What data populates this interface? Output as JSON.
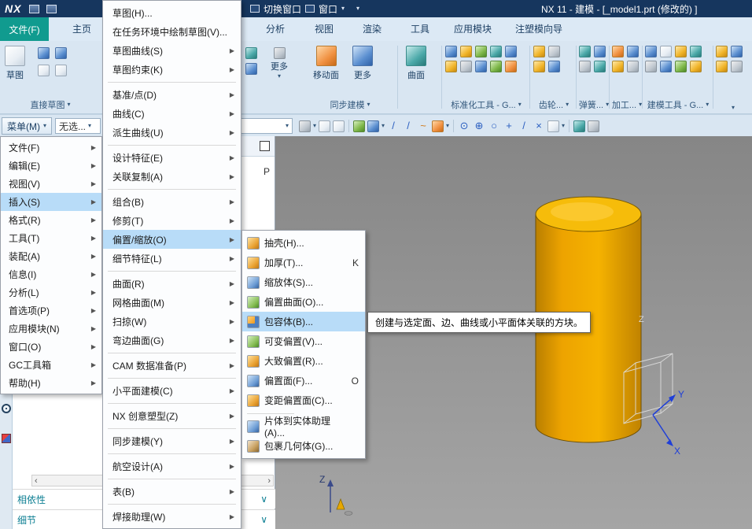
{
  "glyphs": {
    "caret": "▾",
    "arrow": "▶",
    "chevron_down": "∨",
    "scroll_left": "‹",
    "scroll_right": "›"
  },
  "title_bar": {
    "logo": "NX",
    "switch_window": "切换窗口",
    "window_menu": "窗口",
    "title": "NX 11 - 建模 - [_model1.prt (修改的) ]"
  },
  "tabs": {
    "file": "文件(F)",
    "items": [
      {
        "label": "主页"
      },
      {
        "label": "分析"
      },
      {
        "label": "视图"
      },
      {
        "label": "渲染"
      },
      {
        "label": "工具"
      },
      {
        "label": "应用模块"
      },
      {
        "label": "注塑模向导"
      }
    ]
  },
  "ribbon": {
    "sketch_button": "草图",
    "more_button": "更多",
    "move_face_button": "移动面",
    "more2_button": "更多",
    "surface_button": "曲面",
    "groups": [
      {
        "label": "直接草图"
      },
      {
        "label": "同步建模"
      },
      {
        "label": "标准化工具 - G..."
      },
      {
        "label": "齿轮..."
      },
      {
        "label": "弹簧..."
      },
      {
        "label": "加工..."
      },
      {
        "label": "建模工具 - G..."
      }
    ]
  },
  "selection_bar": {
    "menu_button": "菜单(M)",
    "filter": "无选...",
    "snap_icons": [
      {
        "glyph": "⊙",
        "icon": "snap-arc-center-icon"
      },
      {
        "glyph": "⊕",
        "icon": "snap-intersection-icon"
      },
      {
        "glyph": "○",
        "icon": "snap-circle-icon"
      },
      {
        "glyph": "+",
        "icon": "snap-point-icon"
      },
      {
        "glyph": "/",
        "icon": "snap-midpoint-icon"
      },
      {
        "glyph": "×",
        "icon": "snap-endpoint-icon"
      }
    ]
  },
  "main_menu": {
    "items": [
      {
        "label": "文件(F)"
      },
      {
        "label": "编辑(E)"
      },
      {
        "label": "视图(V)"
      },
      {
        "label": "插入(S)",
        "highlighted": true
      },
      {
        "label": "格式(R)"
      },
      {
        "label": "工具(T)"
      },
      {
        "label": "装配(A)"
      },
      {
        "label": "信息(I)"
      },
      {
        "label": "分析(L)"
      },
      {
        "label": "首选项(P)"
      },
      {
        "label": "应用模块(N)"
      },
      {
        "label": "窗口(O)"
      },
      {
        "label": "GC工具箱"
      },
      {
        "label": "帮助(H)"
      }
    ]
  },
  "insert_menu": {
    "items": [
      {
        "label": "草图(H)..."
      },
      {
        "label": "在任务环境中绘制草图(V)..."
      },
      {
        "label": "草图曲线(S)",
        "arrow": "▶"
      },
      {
        "label": "草图约束(K)",
        "arrow": "▶"
      },
      {
        "separator": true
      },
      {
        "label": "基准/点(D)",
        "arrow": "▶"
      },
      {
        "label": "曲线(C)",
        "arrow": "▶"
      },
      {
        "label": "派生曲线(U)",
        "arrow": "▶"
      },
      {
        "separator": true
      },
      {
        "label": "设计特征(E)",
        "arrow": "▶"
      },
      {
        "label": "关联复制(A)",
        "arrow": "▶"
      },
      {
        "separator": true
      },
      {
        "label": "组合(B)",
        "arrow": "▶"
      },
      {
        "label": "修剪(T)",
        "arrow": "▶"
      },
      {
        "label": "偏置/缩放(O)",
        "arrow": "▶",
        "highlighted": true
      },
      {
        "label": "细节特征(L)",
        "arrow": "▶"
      },
      {
        "separator": true
      },
      {
        "label": "曲面(R)",
        "arrow": "▶"
      },
      {
        "label": "网格曲面(M)",
        "arrow": "▶"
      },
      {
        "label": "扫掠(W)",
        "arrow": "▶"
      },
      {
        "label": "弯边曲面(G)",
        "arrow": "▶"
      },
      {
        "separator": true
      },
      {
        "label": "CAM 数据准备(P)",
        "arrow": "▶"
      },
      {
        "separator": true
      },
      {
        "label": "小平面建模(C)",
        "arrow": "▶"
      },
      {
        "separator": true
      },
      {
        "label": "NX 创意塑型(Z)",
        "arrow": "▶"
      },
      {
        "separator": true
      },
      {
        "label": "同步建模(Y)",
        "arrow": "▶"
      },
      {
        "separator": true
      },
      {
        "label": "航空设计(A)",
        "arrow": "▶"
      },
      {
        "separator": true
      },
      {
        "label": "表(B)",
        "arrow": "▶"
      },
      {
        "separator": true
      },
      {
        "label": "焊接助理(W)",
        "arrow": "▶"
      }
    ]
  },
  "offset_menu": {
    "items": [
      {
        "label": "抽壳(H)...",
        "icon": "shell-icon"
      },
      {
        "label": "加厚(T)...",
        "icon": "thicken-icon",
        "shortcut": "K"
      },
      {
        "label": "缩放体(S)...",
        "icon": "scale-body-icon"
      },
      {
        "label": "偏置曲面(O)...",
        "icon": "offset-surface-icon"
      },
      {
        "label": "包容体(B)...",
        "icon": "bounding-body-icon",
        "highlighted": true
      },
      {
        "label": "可变偏置(V)...",
        "icon": "variable-offset-icon"
      },
      {
        "label": "大致偏置(R)...",
        "icon": "rough-offset-icon"
      },
      {
        "label": "偏置面(F)...",
        "icon": "offset-face-icon",
        "shortcut": "O"
      },
      {
        "label": "变距偏置面(C)...",
        "icon": "offset-face-distance-icon"
      },
      {
        "separator": true
      },
      {
        "label": "片体到实体助理(A)...",
        "icon": "sheet-to-solid-icon"
      },
      {
        "label": "包裹几何体(G)...",
        "icon": "wrap-geometry-icon"
      }
    ]
  },
  "tooltip": {
    "text": "创建与选定面、边、曲线或小平面体关联的方块。"
  },
  "navigator": {
    "column_label": "P"
  },
  "resource_panel": {
    "sections": [
      {
        "label": "相依性"
      },
      {
        "label": "细节"
      }
    ]
  },
  "viewport": {
    "axis_x": "X",
    "axis_y": "Y",
    "axis_z": "Z",
    "datum_z": "Z"
  },
  "colors": {
    "titlebar": "#16365e",
    "file_tab": "#109b8f",
    "menu_highlight": "#b8dcf8",
    "cylinder": "#eda500"
  }
}
